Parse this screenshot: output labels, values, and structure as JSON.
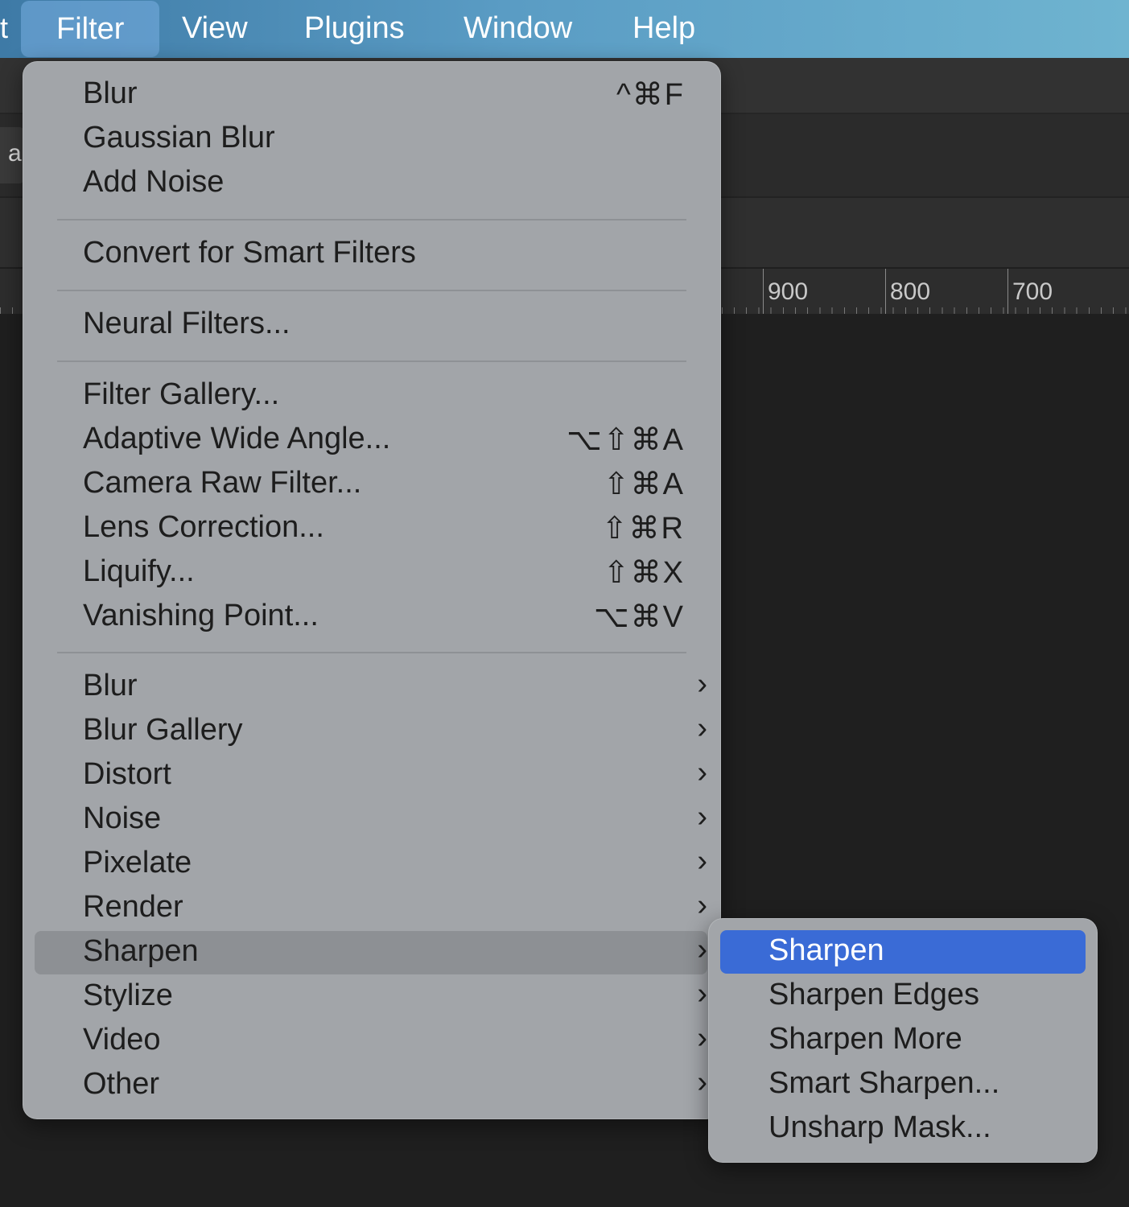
{
  "menubar": {
    "partial_label": "t",
    "items": [
      "Filter",
      "View",
      "Plugins",
      "Window",
      "Help"
    ],
    "active": "Filter"
  },
  "background": {
    "tab_fragment": "a",
    "ruler_labels": [
      "900",
      "800",
      "700"
    ]
  },
  "filter_menu": {
    "group1": [
      {
        "label": "Blur",
        "shortcut": "^⌘F"
      },
      {
        "label": "Gaussian Blur",
        "shortcut": ""
      },
      {
        "label": "Add Noise",
        "shortcut": ""
      }
    ],
    "group2": [
      {
        "label": "Convert for Smart Filters",
        "shortcut": ""
      }
    ],
    "group3": [
      {
        "label": "Neural Filters...",
        "shortcut": ""
      }
    ],
    "group4": [
      {
        "label": "Filter Gallery...",
        "shortcut": ""
      },
      {
        "label": "Adaptive Wide Angle...",
        "shortcut": "⌥⇧⌘A"
      },
      {
        "label": "Camera Raw Filter...",
        "shortcut": "⇧⌘A"
      },
      {
        "label": "Lens Correction...",
        "shortcut": "⇧⌘R"
      },
      {
        "label": "Liquify...",
        "shortcut": "⇧⌘X"
      },
      {
        "label": "Vanishing Point...",
        "shortcut": "⌥⌘V"
      }
    ],
    "submenus": [
      "Blur",
      "Blur Gallery",
      "Distort",
      "Noise",
      "Pixelate",
      "Render",
      "Sharpen",
      "Stylize",
      "Video",
      "Other"
    ],
    "highlighted_submenu": "Sharpen",
    "chevron_glyph": "›"
  },
  "sharpen_submenu": {
    "items": [
      "Sharpen",
      "Sharpen Edges",
      "Sharpen More",
      "Smart Sharpen...",
      "Unsharp Mask..."
    ],
    "selected": "Sharpen"
  },
  "colors": {
    "selection_blue": "#3a6bd6",
    "menu_bg": "#a2a5a9",
    "menubar_start": "#3e7aa6",
    "menubar_end": "#6fb4d0"
  }
}
